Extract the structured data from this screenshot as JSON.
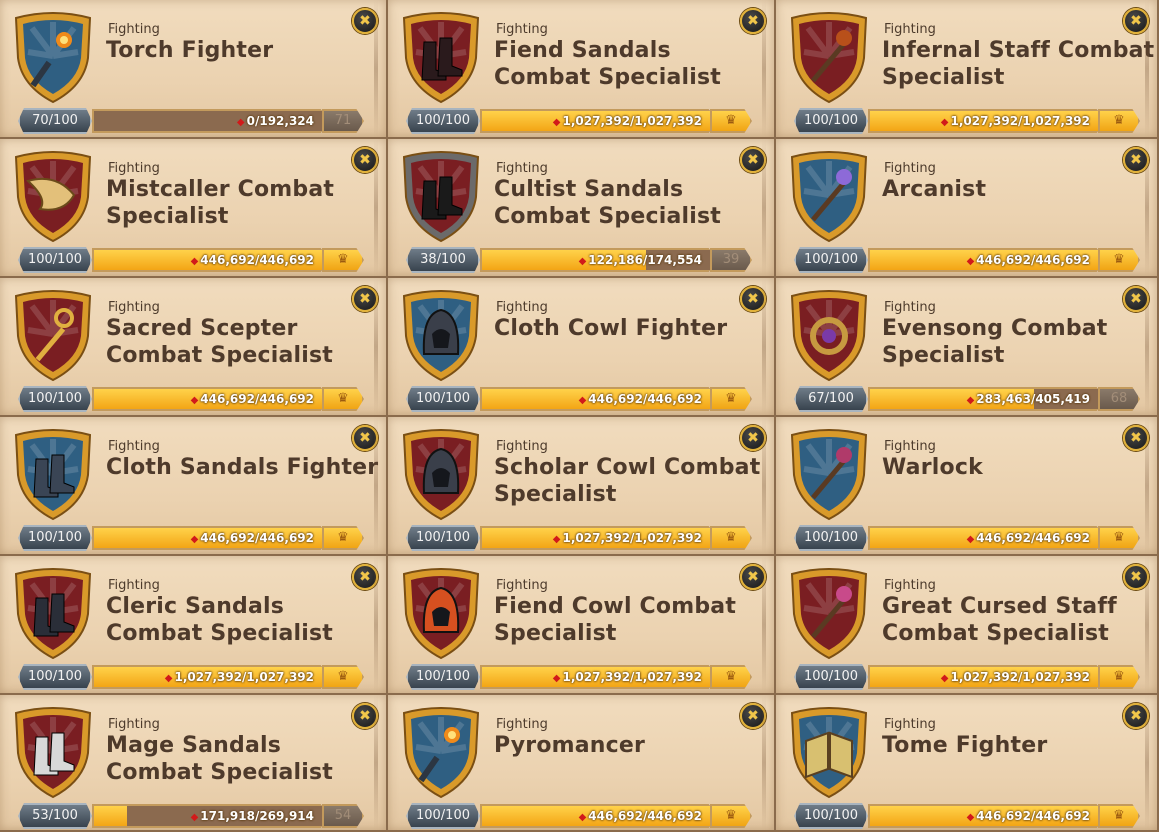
{
  "cards": [
    {
      "category": "Fighting",
      "title": "Torch Fighter",
      "level": "70/100",
      "xp": "0/192,324",
      "progress": 0,
      "next": "71",
      "shield": "blue",
      "item": "torch-icon",
      "item_color": "#2c3642"
    },
    {
      "category": "Fighting",
      "title": "Fiend Sandals Combat Specialist",
      "level": "100/100",
      "xp": "1,027,392/1,027,392",
      "progress": 1,
      "next": null,
      "shield": "red",
      "item": "boots-icon",
      "item_color": "#2a1a1c"
    },
    {
      "category": "Fighting",
      "title": "Infernal Staff Combat Specialist",
      "level": "100/100",
      "xp": "1,027,392/1,027,392",
      "progress": 1,
      "next": null,
      "shield": "red",
      "item": "staff-icon",
      "item_color": "#b8501a"
    },
    {
      "category": "Fighting",
      "title": "Mistcaller Combat Specialist",
      "level": "100/100",
      "xp": "446,692/446,692",
      "progress": 1,
      "next": null,
      "shield": "red",
      "item": "horn-icon",
      "item_color": "#e3c07a"
    },
    {
      "category": "Fighting",
      "title": "Cultist Sandals Combat Specialist",
      "level": "38/100",
      "xp": "122,186/174,554",
      "progress": 0.7,
      "next": "39",
      "shield": "grey-red",
      "item": "boots-icon",
      "item_color": "#1a1a1a"
    },
    {
      "category": "Fighting",
      "title": "Arcanist",
      "level": "100/100",
      "xp": "446,692/446,692",
      "progress": 1,
      "next": null,
      "shield": "blue",
      "item": "staff-icon",
      "item_color": "#8d6ad8"
    },
    {
      "category": "Fighting",
      "title": "Sacred Scepter Combat Specialist",
      "level": "100/100",
      "xp": "446,692/446,692",
      "progress": 1,
      "next": null,
      "shield": "red",
      "item": "scepter-icon",
      "item_color": "#e0b040"
    },
    {
      "category": "Fighting",
      "title": "Cloth Cowl Fighter",
      "level": "100/100",
      "xp": "446,692/446,692",
      "progress": 1,
      "next": null,
      "shield": "blue",
      "item": "cowl-icon",
      "item_color": "#3a3f4a"
    },
    {
      "category": "Fighting",
      "title": "Evensong Combat Specialist",
      "level": "67/100",
      "xp": "283,463/405,419",
      "progress": 0.7,
      "next": "68",
      "shield": "red",
      "item": "ring-icon",
      "item_color": "#c79a40"
    },
    {
      "category": "Fighting",
      "title": "Cloth Sandals Fighter",
      "level": "100/100",
      "xp": "446,692/446,692",
      "progress": 1,
      "next": null,
      "shield": "blue",
      "item": "boots-icon",
      "item_color": "#3a4555"
    },
    {
      "category": "Fighting",
      "title": "Scholar Cowl Combat Specialist",
      "level": "100/100",
      "xp": "1,027,392/1,027,392",
      "progress": 1,
      "next": null,
      "shield": "red",
      "item": "cowl-icon",
      "item_color": "#3a3f4a"
    },
    {
      "category": "Fighting",
      "title": "Warlock",
      "level": "100/100",
      "xp": "446,692/446,692",
      "progress": 1,
      "next": null,
      "shield": "blue",
      "item": "staff-icon",
      "item_color": "#b03a6a"
    },
    {
      "category": "Fighting",
      "title": "Cleric Sandals Combat Specialist",
      "level": "100/100",
      "xp": "1,027,392/1,027,392",
      "progress": 1,
      "next": null,
      "shield": "red",
      "item": "boots-icon",
      "item_color": "#2a2e38"
    },
    {
      "category": "Fighting",
      "title": "Fiend Cowl Combat Specialist",
      "level": "100/100",
      "xp": "1,027,392/1,027,392",
      "progress": 1,
      "next": null,
      "shield": "red",
      "item": "cowl-icon",
      "item_color": "#d65020"
    },
    {
      "category": "Fighting",
      "title": "Great Cursed Staff Combat Specialist",
      "level": "100/100",
      "xp": "1,027,392/1,027,392",
      "progress": 1,
      "next": null,
      "shield": "red",
      "item": "staff-icon",
      "item_color": "#c84a8a"
    },
    {
      "category": "Fighting",
      "title": "Mage Sandals Combat Specialist",
      "level": "53/100",
      "xp": "171,918/269,914",
      "progress": 0.14,
      "next": "54",
      "shield": "red",
      "item": "boots-icon",
      "item_color": "#d8d8d8"
    },
    {
      "category": "Fighting",
      "title": "Pyromancer",
      "level": "100/100",
      "xp": "446,692/446,692",
      "progress": 1,
      "next": null,
      "shield": "blue",
      "item": "torch-icon",
      "item_color": "#2c3642"
    },
    {
      "category": "Fighting",
      "title": "Tome Fighter",
      "level": "100/100",
      "xp": "446,692/446,692",
      "progress": 1,
      "next": null,
      "shield": "blue",
      "item": "tome-icon",
      "item_color": "#d8c070"
    }
  ],
  "colors": {
    "shield_blue": "#2f5f82",
    "shield_red": "#7a1e22",
    "shield_grey_red": "#6b6a6a",
    "shield_rim": "#d99a2a",
    "xp_fill": "#f7b21e",
    "xp_track": "#8b6a4f",
    "level_badge": "#4a5663",
    "close_button": "#1e1e1e",
    "title_text": "#4e3a2b"
  },
  "icons": {
    "close": "close-icon",
    "reward": "reward-trophy-icon",
    "xp": "fame-gem-icon"
  },
  "close_glyph": "✖",
  "reward_glyph": "♛"
}
